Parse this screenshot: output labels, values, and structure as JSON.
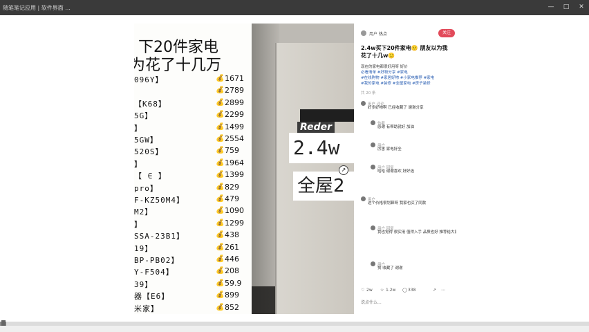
{
  "window": {
    "tab_text": "随笔笔记应用   |   软件界面   ...",
    "controls": [
      "—",
      "□",
      "✕"
    ]
  },
  "paper": {
    "title_line1": "下20件家电",
    "title_line2": "为花了十几万",
    "rows": [
      {
        "model": "096Y】",
        "price": "1671"
      },
      {
        "model": "",
        "price": "2789"
      },
      {
        "model": "【K68】",
        "price": "2899"
      },
      {
        "model": "5G】",
        "price": "2299"
      },
      {
        "model": "】",
        "price": "1499"
      },
      {
        "model": "5GW】",
        "price": "2554"
      },
      {
        "model": "520S】",
        "price": "759"
      },
      {
        "model": "】",
        "price": "1964"
      },
      {
        "model": "【 ∈ 】",
        "price": "1399"
      },
      {
        "model": "pro】",
        "price": "829"
      },
      {
        "model": "F-KZ50M4】",
        "price": "479"
      },
      {
        "model": "M2】",
        "price": "1090"
      },
      {
        "model": "】",
        "price": "1299"
      },
      {
        "model": "SSA-23B1】",
        "price": "438"
      },
      {
        "model": "19】",
        "price": "261"
      },
      {
        "model": "BP-PB02】",
        "price": "446"
      },
      {
        "model": "Y-F504】",
        "price": "208"
      },
      {
        "model": "39】",
        "price": "59.9"
      },
      {
        "model": "器【E6】",
        "price": "899"
      },
      {
        "model": "米家】",
        "price": "852"
      }
    ]
  },
  "photo": {
    "brand": "Reder",
    "subtitle1": "2.4w",
    "subtitle2": "全屋2"
  },
  "side": {
    "username": "用户",
    "follow_text": "热点",
    "follow_button": "关注",
    "post_title": "2.4w买下20件家电🙂 朋友以为我花了十几w🙂",
    "lines": [
      "现在的家电都很好用呀 好价",
      "必看清单 #好物分享 #家电",
      "#在线购物 #家居好物 #小家电推荐 #家电",
      "#我的家电 #装修 #全屋家电 #房子装修",
      "共 20 条"
    ],
    "comments": [
      {
        "name": "用户 评论",
        "text": "好多好物啊 已经收藏了 谢谢分享"
      },
      {
        "name": "作者",
        "text": "感谢 有帮助就好 加油"
      },
      {
        "name": "用户",
        "text": "厉害 家电好全"
      },
      {
        "name": "用户 回复",
        "text": "哈哈 谢谢喜欢 好好选"
      },
      {
        "name": "用户",
        "text": "这个价格很划算呀 我家也买了同款"
      },
      {
        "name": "用户 回复",
        "text": "我也觉得 很实用 值得入手 品质也好 推荐给大家"
      },
      {
        "name": "用户",
        "text": "赞 收藏了 谢谢"
      }
    ],
    "stats": {
      "likes": "2w",
      "collects": "1.2w",
      "comments": "338"
    },
    "input_placeholder": "说点什么..."
  },
  "playback": {
    "progress": 0.01
  }
}
